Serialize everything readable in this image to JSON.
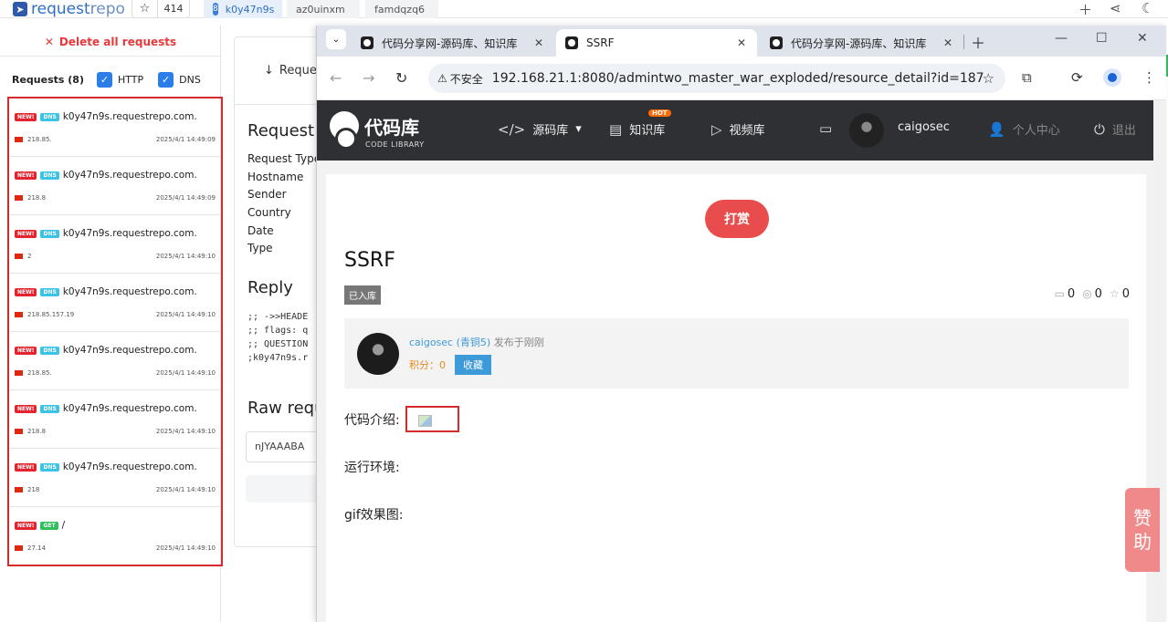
{
  "rr": {
    "logo_text_a": "request",
    "logo_text_b": "repo",
    "stars": "414",
    "tabs": [
      {
        "num": "8",
        "label": "k0y47n9s"
      },
      {
        "label": "az0uinxm"
      },
      {
        "label": "famdqzq6"
      }
    ],
    "delete_label": "Delete all requests",
    "requests_label": "Requests (8)",
    "filter_http": "HTTP",
    "filter_dns": "DNS",
    "requests": [
      {
        "badge1": "NEW!",
        "badge2": "DNS",
        "host": "k0y47n9s.requestrepo.com.",
        "ip": "218.85.",
        "time": "2025/4/1 14:49:09"
      },
      {
        "badge1": "NEW!",
        "badge2": "DNS",
        "host": "k0y47n9s.requestrepo.com.",
        "ip": "218.8",
        "time": "2025/4/1 14:49:09"
      },
      {
        "badge1": "NEW!",
        "badge2": "DNS",
        "host": "k0y47n9s.requestrepo.com.",
        "ip": "2",
        "time": "2025/4/1 14:49:10"
      },
      {
        "badge1": "NEW!",
        "badge2": "DNS",
        "host": "k0y47n9s.requestrepo.com.",
        "ip": "218.85.157.19",
        "time": "2025/4/1 14:49:10"
      },
      {
        "badge1": "NEW!",
        "badge2": "DNS",
        "host": "k0y47n9s.requestrepo.com.",
        "ip": "218.85.",
        "time": "2025/4/1 14:49:10"
      },
      {
        "badge1": "NEW!",
        "badge2": "DNS",
        "host": "k0y47n9s.requestrepo.com.",
        "ip": "218.8",
        "time": "2025/4/1 14:49:10"
      },
      {
        "badge1": "NEW!",
        "badge2": "DNS",
        "host": "k0y47n9s.requestrepo.com.",
        "ip": "218",
        "time": "2025/4/1 14:49:10"
      },
      {
        "badge1": "NEW!",
        "badge2": "GET",
        "host": "/",
        "ip": "27.14",
        "time": "2025/4/1 14:49:10"
      }
    ],
    "main_tab": "Reque",
    "request_title": "Request I",
    "kv_labels": [
      "Request Type",
      "Hostname",
      "Sender",
      "Country",
      "Date",
      "Type"
    ],
    "reply_title": "Reply",
    "reply_lines": [
      ";; ->>HEADE",
      ";; flags: q",
      ";; QUESTION",
      ";k0y47n9s.r"
    ],
    "raw_title": "Raw requ",
    "raw_value": "nJYAAABA"
  },
  "browser": {
    "tabs": [
      {
        "title": "代码分享网-源码库、知识库"
      },
      {
        "title": "SSRF"
      },
      {
        "title": "代码分享网-源码库、知识库"
      }
    ],
    "not_secure": "不安全",
    "url": "192.168.21.1:8080/admintwo_master_war_exploded/resource_detail?id=187"
  },
  "site": {
    "name": "代码库",
    "sub": "CODE LIBRARY",
    "nav": [
      {
        "label": "源码库"
      },
      {
        "label": "知识库"
      },
      {
        "label": "视频库"
      },
      {
        "label": "caigosec"
      },
      {
        "label": "个人中心"
      },
      {
        "label": "退出"
      }
    ],
    "hot": "HOT",
    "reward": "打赏",
    "post_title": "SSRF",
    "tag": "已入库",
    "stats": [
      "0",
      "0",
      "0"
    ],
    "author": "caigosec",
    "author_level": "(青铜5)",
    "posted": "发布于刚刚",
    "score": "积分：0",
    "fav": "收藏",
    "sec_intro": "代码介绍:",
    "sec_env": "运行环境:",
    "sec_gif": "gif效果图:",
    "praise": [
      "赞",
      "助"
    ]
  }
}
